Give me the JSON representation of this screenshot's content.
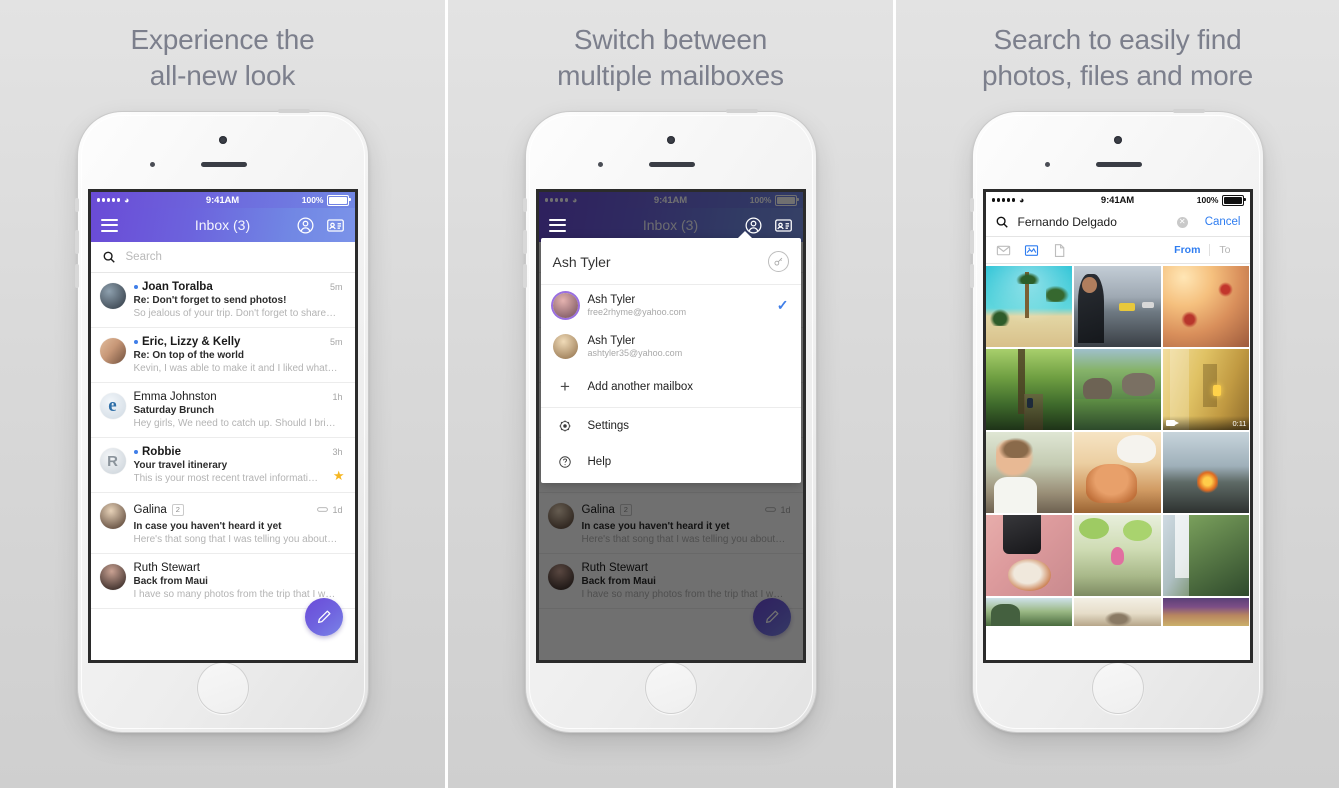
{
  "panels": [
    {
      "headline_line1": "Experience the",
      "headline_line2": "all-new look"
    },
    {
      "headline_line1": "Switch between",
      "headline_line2": "multiple mailboxes"
    },
    {
      "headline_line1": "Search to easily find",
      "headline_line2": "photos, files and more"
    }
  ],
  "status_bar": {
    "time": "9:41AM",
    "battery": "100%",
    "carrier_dots": 5,
    "wifi_icon": "wifi-icon"
  },
  "inbox": {
    "title": "Inbox (3)",
    "menu_icon": "hamburger-menu-icon",
    "account_icon": "account-circle-icon",
    "contacts_icon": "contact-card-icon",
    "search_icon": "search-icon",
    "search_placeholder": "Search",
    "compose_icon": "compose-pencil-icon",
    "emails": [
      {
        "sender": "Joan Toralba",
        "subject": "Re: Don't forget to send photos!",
        "preview": "So jealous of your trip. Don't forget to share…",
        "time": "5m",
        "unread": true,
        "starred": false,
        "attachment": false,
        "count": "",
        "avatar_type": "photo",
        "avatar_colors": [
          "#6d7d8c",
          "#2d3640"
        ],
        "initial": ""
      },
      {
        "sender": "Eric, Lizzy & Kelly",
        "subject": "Re: On top of the world",
        "preview": "Kevin, I was able to make it and I liked what…",
        "time": "5m",
        "unread": true,
        "starred": false,
        "attachment": false,
        "count": "",
        "avatar_type": "photo",
        "avatar_colors": [
          "#d8b49a",
          "#8a6a53"
        ],
        "initial": ""
      },
      {
        "sender": "Emma Johnston",
        "subject": "Saturday Brunch",
        "preview": "Hey girls, We need to catch up. Should I bri…",
        "time": "1h",
        "unread": false,
        "starred": false,
        "attachment": false,
        "count": "",
        "avatar_type": "letter",
        "avatar_colors": [
          "#e9eef3",
          "#cdd7e0"
        ],
        "initial": "e"
      },
      {
        "sender": "Robbie",
        "subject": "Your travel itinerary",
        "preview": "This is your most recent travel informati…",
        "time": "3h",
        "unread": true,
        "starred": true,
        "attachment": false,
        "count": "",
        "avatar_type": "letter",
        "avatar_colors": [
          "#eceff1",
          "#c6ced6"
        ],
        "initial": "R"
      },
      {
        "sender": "Galina",
        "subject": "In case you haven't heard it yet",
        "preview": "Here's that song that I was telling you about…",
        "time": "1d",
        "unread": false,
        "starred": false,
        "attachment": true,
        "count": "2",
        "avatar_type": "photo",
        "avatar_colors": [
          "#d9c3aa",
          "#5b4638"
        ],
        "initial": ""
      },
      {
        "sender": "Ruth Stewart",
        "subject": "Back from Maui",
        "preview": "I have so many photos from the trip that I w…",
        "time": "",
        "unread": false,
        "starred": false,
        "attachment": false,
        "count": "",
        "avatar_type": "photo",
        "avatar_colors": [
          "#b08a78",
          "#221a18"
        ],
        "initial": ""
      }
    ]
  },
  "mailbox_sheet": {
    "header_name": "Ash Tyler",
    "key_icon": "key-icon",
    "accounts": [
      {
        "name": "Ash Tyler",
        "email": "free2rhyme@yahoo.com",
        "selected": true,
        "check_icon": "checkmark-icon",
        "avatar_colors": [
          "#d6a3a0",
          "#6e4b57"
        ]
      },
      {
        "name": "Ash Tyler",
        "email": "ashtyler35@yahoo.com",
        "selected": false,
        "check_icon": "",
        "avatar_colors": [
          "#e0c9a8",
          "#9a7a55"
        ]
      }
    ],
    "add_mailbox_label": "Add another mailbox",
    "add_icon": "plus-icon",
    "menu": [
      {
        "label": "Settings",
        "icon": "gear-icon"
      },
      {
        "label": "Help",
        "icon": "question-circle-icon"
      }
    ]
  },
  "search_screen": {
    "search_icon": "search-icon",
    "query": "Fernando Delgado",
    "clear_icon": "clear-circle-icon",
    "cancel_label": "Cancel",
    "filters": [
      {
        "name": "mail-filter-icon",
        "active": false
      },
      {
        "name": "photos-filter-icon",
        "active": true
      },
      {
        "name": "documents-filter-icon",
        "active": false
      }
    ],
    "tabs": [
      {
        "label": "From",
        "active": true
      },
      {
        "label": "To",
        "active": false
      }
    ],
    "photos": [
      {
        "alt": "palm-trees-beach",
        "c1": "#2fc4d6",
        "c2": "#e7d9a8",
        "kind": "palms"
      },
      {
        "alt": "woman-overlooking-highway",
        "c1": "#9aa7b4",
        "c2": "#2e3238",
        "kind": "city"
      },
      {
        "alt": "red-flowers-sunlight",
        "c1": "#f3c489",
        "c2": "#b9503a",
        "kind": "flower"
      },
      {
        "alt": "forest-trail-hiker",
        "c1": "#7fae52",
        "c2": "#22381c",
        "kind": "forest"
      },
      {
        "alt": "mossy-coastal-rocks",
        "c1": "#86b36a",
        "c2": "#2c4a56",
        "kind": "coast"
      },
      {
        "alt": "yellow-building-balcony",
        "c1": "#e7c463",
        "c2": "#7a5f2c",
        "kind": "building",
        "duration": "0:11",
        "is_video": true
      },
      {
        "alt": "smiling-girl",
        "c1": "#cfd8c2",
        "c2": "#7d6b58",
        "kind": "portrait"
      },
      {
        "alt": "pastries-and-coffee",
        "c1": "#f0cfa6",
        "c2": "#b0703f",
        "kind": "food"
      },
      {
        "alt": "campfire-at-dusk",
        "c1": "#9fb0ba",
        "c2": "#3a3a38",
        "kind": "fire"
      },
      {
        "alt": "camera-lens-on-pink",
        "c1": "#e0a4a6",
        "c2": "#2a2a2c",
        "kind": "camera"
      },
      {
        "alt": "lotus-bud-lilypads",
        "c1": "#cfe0b0",
        "c2": "#7e8b62",
        "kind": "lotus"
      },
      {
        "alt": "waterfall-cliffs",
        "c1": "#b9c7cf",
        "c2": "#3f5a3e",
        "kind": "waterfall"
      },
      {
        "alt": "green-hillside-lake",
        "c1": "#c6dbe4",
        "c2": "#44603f",
        "kind": "hill"
      },
      {
        "alt": "blurred-bird-closeup",
        "c1": "#efe9dd",
        "c2": "#8a7a64",
        "kind": "bird"
      },
      {
        "alt": "purple-sunset-field",
        "c1": "#6b4b8c",
        "c2": "#d8b86a",
        "kind": "sunset"
      }
    ]
  },
  "colors": {
    "header_gradient_start": "#6a4bd6",
    "header_gradient_end": "#7b93e9",
    "accent_blue": "#2f7df0",
    "unread_dot": "#3f7ee8",
    "star": "#f5b622",
    "page_background": "#d9d9d9",
    "headline_text": "#7c7f8c"
  }
}
